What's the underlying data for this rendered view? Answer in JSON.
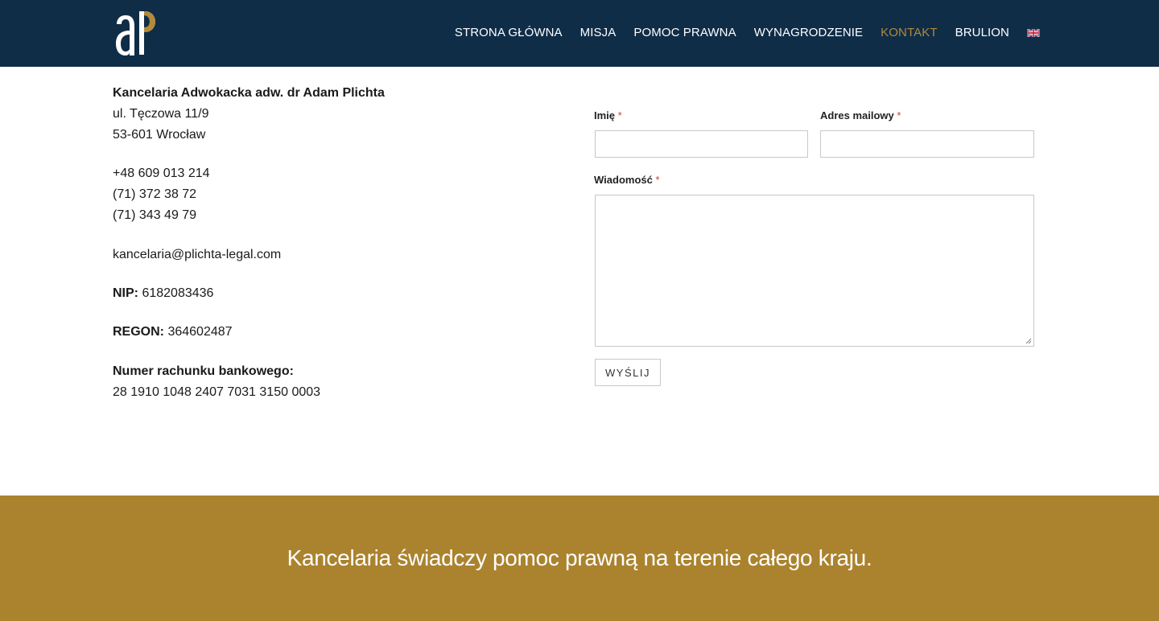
{
  "nav": {
    "items": [
      {
        "label": "STRONA GŁÓWNA"
      },
      {
        "label": "MISJA"
      },
      {
        "label": "POMOC PRAWNA"
      },
      {
        "label": "WYNAGRODZENIE"
      },
      {
        "label": "KONTAKT"
      },
      {
        "label": "BRULION"
      }
    ],
    "active_index": 4,
    "active_color": "#b4893a",
    "language_icon": "uk-flag-icon"
  },
  "logo": {
    "icon": "ap-monogram-logo",
    "accent": "#b4893a"
  },
  "contact": {
    "firm_name": "Kancelaria Adwokacka adw. dr Adam Plichta",
    "street": "ul. Tęczowa 11/9",
    "city": "53-601 Wrocław",
    "phones": [
      "+48 609 013 214",
      "(71) 372 38 72",
      "(71) 343 49 79"
    ],
    "email": "kancelaria@plichta-legal.com",
    "nip_label": "NIP:",
    "nip_value": "6182083436",
    "regon_label": "REGON:",
    "regon_value": "364602487",
    "bank_label": "Numer rachunku bankowego:",
    "bank_value": "28 1910 1048 2407 7031 3150 0003"
  },
  "form": {
    "name_label": "Imię",
    "email_label": "Adres mailowy",
    "message_label": "Wiadomość",
    "required_mark": "*",
    "name_value": "",
    "email_value": "",
    "message_value": "",
    "submit_label": "WYŚLIJ"
  },
  "footer": {
    "tagline": "Kancelaria świadczy pomoc prawną na terenie całego kraju.",
    "background": "#ab832e"
  }
}
